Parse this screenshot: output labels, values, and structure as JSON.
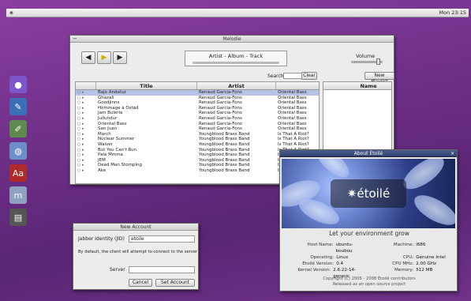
{
  "menubar": {
    "logo_icon": "star-icon",
    "clock": "Mon 23:15"
  },
  "dock": {
    "items": [
      {
        "name": "dock-orb",
        "color": "#7d56c9",
        "glyph": "●"
      },
      {
        "name": "dock-shell",
        "color": "#3c6fb6",
        "glyph": "✎"
      },
      {
        "name": "dock-paint",
        "color": "#5f8a4d",
        "glyph": "✐"
      },
      {
        "name": "dock-globe",
        "color": "#6d8fc9",
        "glyph": "◍"
      },
      {
        "name": "dock-dictionary",
        "color": "#b02a2a",
        "glyph": "Aa"
      },
      {
        "name": "dock-chat",
        "color": "#8fa2c0",
        "glyph": "m"
      },
      {
        "name": "dock-printer",
        "color": "#555555",
        "glyph": "▤"
      }
    ]
  },
  "melodie": {
    "title": "Melodie",
    "track_label": "Artist - Album - Track",
    "volume_label": "Volume",
    "volume_level": 0.85,
    "search_label": "Search",
    "clear_label": "Clear",
    "new_playlist_label": "New Playlist",
    "columns": [
      "",
      "Title",
      "Artist",
      ""
    ],
    "playlist_column": "Name",
    "rows": [
      {
        "title": "Bajo Andaluz",
        "artist": "Renaud Garcia-Fons",
        "album": "Oriental Bass",
        "selected": true
      },
      {
        "title": "Ghazali",
        "artist": "Renaud Garcia-Fons",
        "album": "Oriental Bass",
        "selected": false
      },
      {
        "title": "Goodjinns",
        "artist": "Renaud Garcia-Fons",
        "album": "Oriental Bass",
        "selected": false
      },
      {
        "title": "Hommage à Ostâd",
        "artist": "Renaud Garcia-Fons",
        "album": "Oriental Bass",
        "selected": false
      },
      {
        "title": "Jam Buleria",
        "artist": "Renaud Garcia-Fons",
        "album": "Oriental Bass",
        "selected": false
      },
      {
        "title": "Jullundur",
        "artist": "Renaud Garcia-Fons",
        "album": "Oriental Bass",
        "selected": false
      },
      {
        "title": "Oriental Bass",
        "artist": "Renaud Garcia-Fons",
        "album": "Oriental Bass",
        "selected": false
      },
      {
        "title": "San Juan",
        "artist": "Renaud Garcia-Fons",
        "album": "Oriental Bass",
        "selected": false
      },
      {
        "title": "March",
        "artist": "Youngblood Brass Band",
        "album": "Is That A Riot?",
        "selected": false
      },
      {
        "title": "Nuclear Summer",
        "artist": "Youngblood Brass Band",
        "album": "Is That A Riot?",
        "selected": false
      },
      {
        "title": "Waiver",
        "artist": "Youngblood Brass Band",
        "album": "Is That A Riot?",
        "selected": false
      },
      {
        "title": "But You Can't Run",
        "artist": "Youngblood Brass Band",
        "album": "Is That A Riot?",
        "selected": false
      },
      {
        "title": "Pala Mmma",
        "artist": "Youngblood Brass Band",
        "album": "Is That A Riot?",
        "selected": false
      },
      {
        "title": "JEM",
        "artist": "Youngblood Brass Band",
        "album": "Is That A Riot?",
        "selected": false
      },
      {
        "title": "Dead Man Stomping",
        "artist": "Youngblood Brass Band",
        "album": "Is That A Riot?",
        "selected": false
      },
      {
        "title": "Ake",
        "artist": "Youngblood Brass Band",
        "album": "Is That A Riot?",
        "selected": false
      }
    ]
  },
  "about": {
    "title": "About Étoilé",
    "logo_text": "✷étoilé",
    "tagline": "Let your environment grow",
    "info": [
      {
        "k": "Host Name:",
        "v": "ubuntu-boubou"
      },
      {
        "k": "Machine:",
        "v": "i686"
      },
      {
        "k": "Operating:",
        "v": "Linux"
      },
      {
        "k": "CPU:",
        "v": "Genuine Intel"
      },
      {
        "k": "Étoilé Version:",
        "v": "0.4"
      },
      {
        "k": "CPU MHz:",
        "v": "2.00 GHz"
      },
      {
        "k": "Kernel Version:",
        "v": "2.6.22-14-generic"
      },
      {
        "k": "Memory:",
        "v": "512 MB"
      }
    ],
    "copyright": "Copyright (C) 2005 - 2008 Étoilé contributors",
    "license": "Released as an open source project"
  },
  "account": {
    "title": "New Account",
    "jabber_label": "Jabber Identity (JID)",
    "jabber_value": "etoile",
    "note": "By default, the client will attempt to connect to the server",
    "server_label": "Server",
    "server_value": "",
    "cancel_label": "Cancel",
    "set_label": "Set Account"
  }
}
